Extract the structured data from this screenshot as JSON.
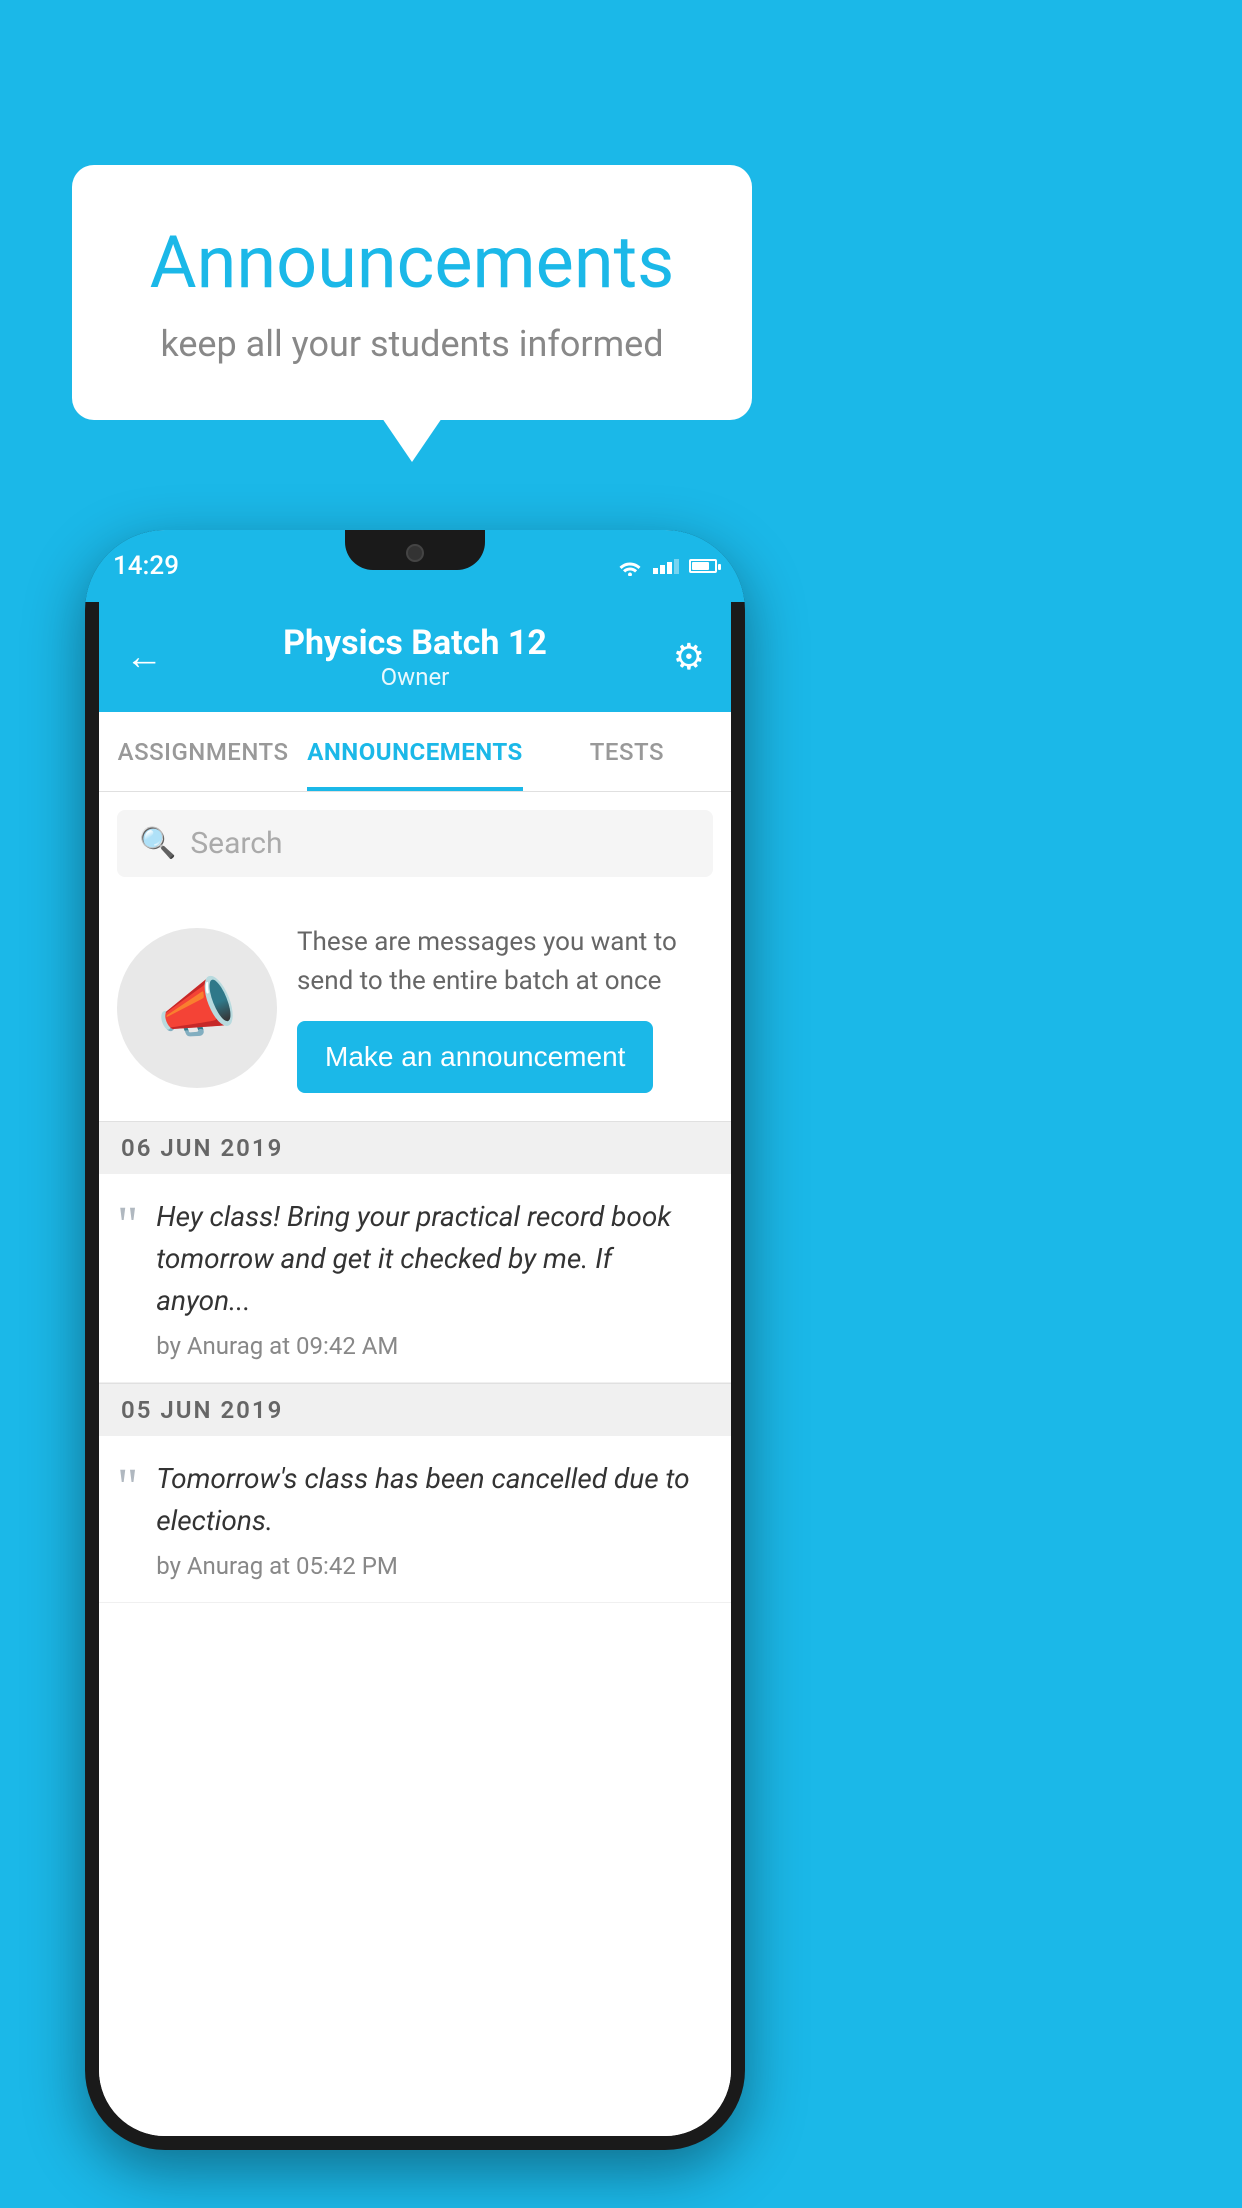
{
  "background": {
    "color": "#1BB8E8"
  },
  "speech_bubble": {
    "title": "Announcements",
    "subtitle": "keep all your students informed"
  },
  "phone": {
    "status_bar": {
      "time": "14:29"
    },
    "header": {
      "back_label": "←",
      "title": "Physics Batch 12",
      "subtitle": "Owner",
      "gear_label": "⚙"
    },
    "tabs": [
      {
        "label": "ASSIGNMENTS",
        "active": false
      },
      {
        "label": "ANNOUNCEMENTS",
        "active": true
      },
      {
        "label": "TESTS",
        "active": false
      }
    ],
    "search": {
      "placeholder": "Search"
    },
    "promo": {
      "description": "These are messages you want to send to the entire batch at once",
      "button_label": "Make an announcement"
    },
    "announcements": [
      {
        "date": "06  JUN  2019",
        "text": "Hey class! Bring your practical record book tomorrow and get it checked by me. If anyon...",
        "author": "by Anurag at 09:42 AM"
      },
      {
        "date": "05  JUN  2019",
        "text": "Tomorrow's class has been cancelled due to elections.",
        "author": "by Anurag at 05:42 PM"
      }
    ]
  }
}
